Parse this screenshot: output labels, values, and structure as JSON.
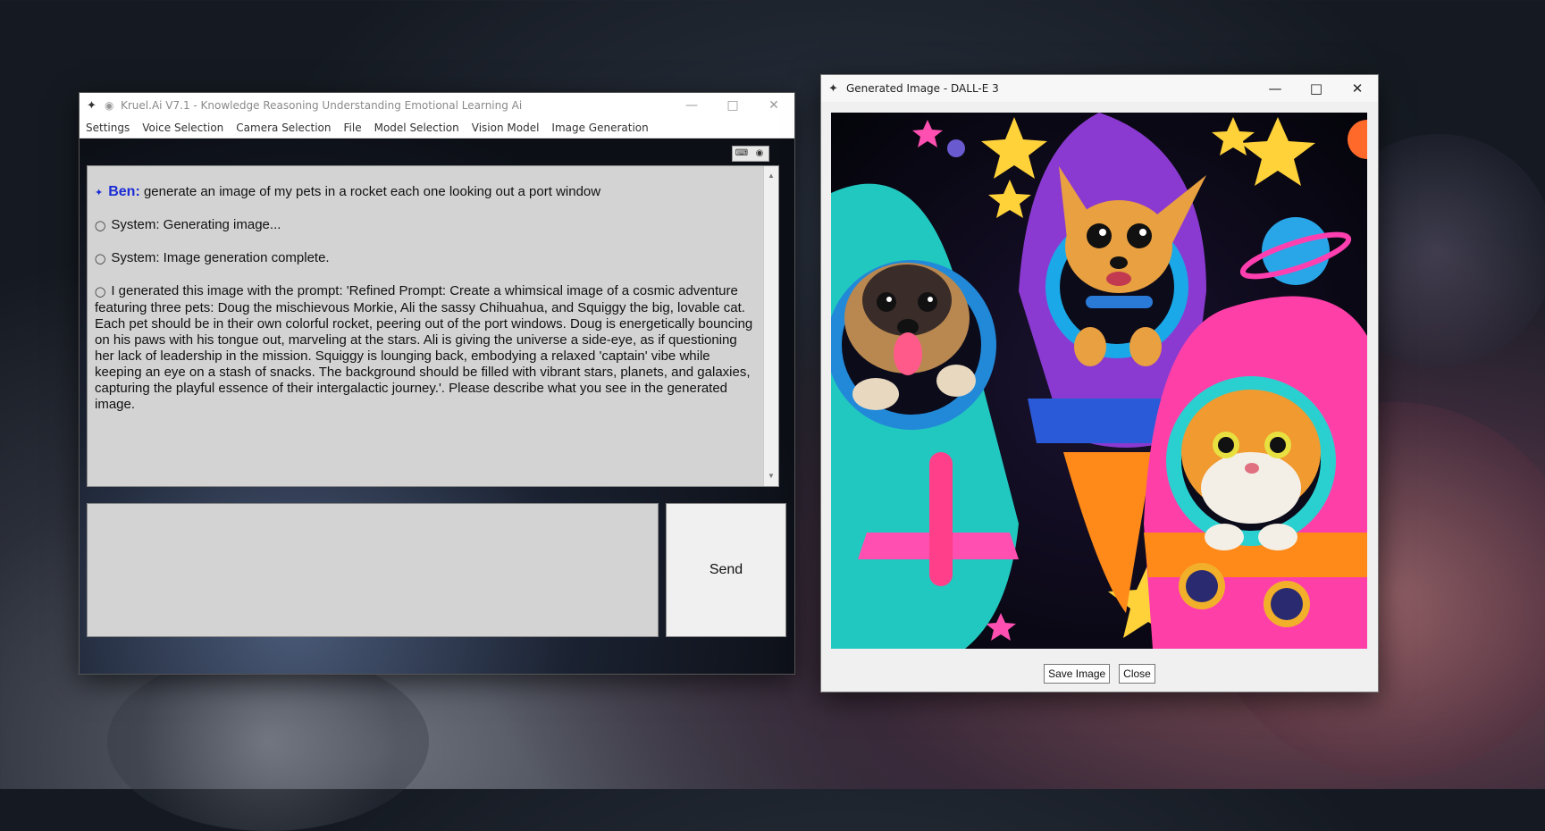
{
  "main_window": {
    "title": "Kruel.Ai V7.1 - Knowledge Reasoning Understanding Emotional Learning Ai",
    "menu": [
      "Settings",
      "Voice Selection",
      "Camera Selection",
      "File",
      "Model Selection",
      "Vision Model",
      "Image Generation"
    ],
    "chat": {
      "user_name": "Ben:",
      "user_message": "generate an image of my pets in a rocket each one looking out a port window",
      "system_1": "System: Generating image...",
      "system_2": "System: Image generation complete.",
      "assistant_message": "I generated this image with the prompt: 'Refined Prompt: Create a whimsical image of a cosmic adventure featuring three pets: Doug the mischievous Morkie, Ali the sassy Chihuahua, and Squiggy the big, lovable cat. Each pet should be in their own colorful rocket, peering out of the port windows. Doug is energetically bouncing on his paws with his tongue out, marveling at the stars. Ali is giving the universe a side-eye, as if questioning her lack of leadership in the mission. Squiggy is lounging back, embodying a relaxed 'captain' vibe while keeping an eye on a stash of snacks. The background should be filled with vibrant stars, planets, and galaxies, capturing the playful essence of their intergalactic journey.'. Please describe what you see in the generated image."
    },
    "send_label": "Send"
  },
  "image_window": {
    "title": "Generated Image - DALL-E 3",
    "save_label": "Save Image",
    "close_label": "Close"
  },
  "colors": {
    "user_name": "#1a2bd6",
    "chat_bg": "#d3d3d3"
  }
}
